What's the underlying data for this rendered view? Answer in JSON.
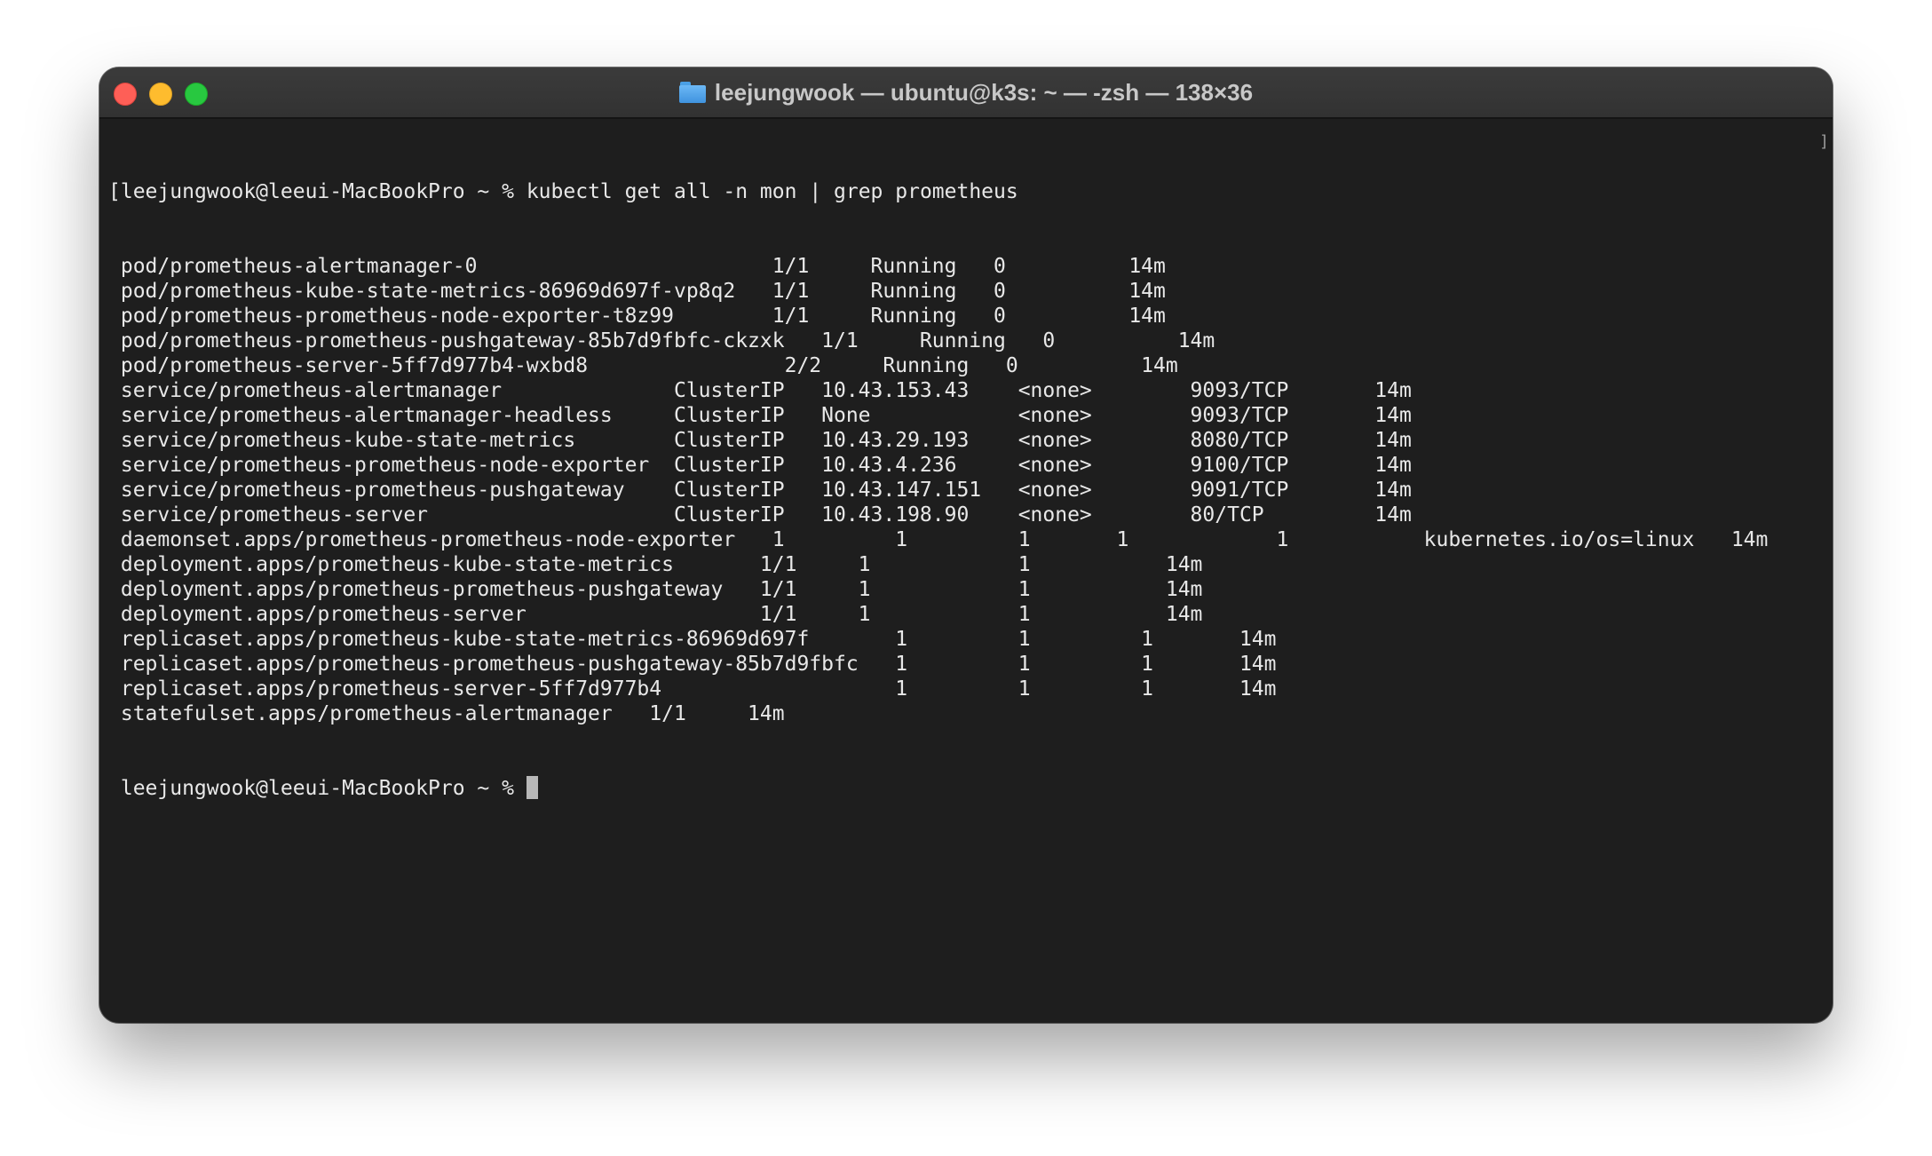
{
  "window": {
    "title": "leejungwook — ubuntu@k3s: ~ — -zsh — 138×36",
    "folder_icon": "folder-icon"
  },
  "terminal": {
    "prompt": "leejungwook@leeui-MacBookPro ~ % ",
    "command": "kubectl get all -n mon | grep prometheus",
    "right_bracket": "]",
    "output_lines": [
      " pod/prometheus-alertmanager-0                        1/1     Running   0          14m",
      " pod/prometheus-kube-state-metrics-86969d697f-vp8q2   1/1     Running   0          14m",
      " pod/prometheus-prometheus-node-exporter-t8z99        1/1     Running   0          14m",
      " pod/prometheus-prometheus-pushgateway-85b7d9fbfc-ckzxk   1/1     Running   0          14m",
      " pod/prometheus-server-5ff7d977b4-wxbd8                2/2     Running   0          14m",
      " service/prometheus-alertmanager              ClusterIP   10.43.153.43    <none>        9093/TCP       14m",
      " service/prometheus-alertmanager-headless     ClusterIP   None            <none>        9093/TCP       14m",
      " service/prometheus-kube-state-metrics        ClusterIP   10.43.29.193    <none>        8080/TCP       14m",
      " service/prometheus-prometheus-node-exporter  ClusterIP   10.43.4.236     <none>        9100/TCP       14m",
      " service/prometheus-prometheus-pushgateway    ClusterIP   10.43.147.151   <none>        9091/TCP       14m",
      " service/prometheus-server                    ClusterIP   10.43.198.90    <none>        80/TCP         14m",
      " daemonset.apps/prometheus-prometheus-node-exporter   1         1         1       1            1           kubernetes.io/os=linux   14m",
      " deployment.apps/prometheus-kube-state-metrics       1/1     1            1           14m",
      " deployment.apps/prometheus-prometheus-pushgateway   1/1     1            1           14m",
      " deployment.apps/prometheus-server                   1/1     1            1           14m",
      " replicaset.apps/prometheus-kube-state-metrics-86969d697f       1         1         1       14m",
      " replicaset.apps/prometheus-prometheus-pushgateway-85b7d9fbfc   1         1         1       14m",
      " replicaset.apps/prometheus-server-5ff7d977b4                   1         1         1       14m",
      " statefulset.apps/prometheus-alertmanager   1/1     14m"
    ],
    "final_prompt": " leejungwook@leeui-MacBookPro ~ % "
  }
}
